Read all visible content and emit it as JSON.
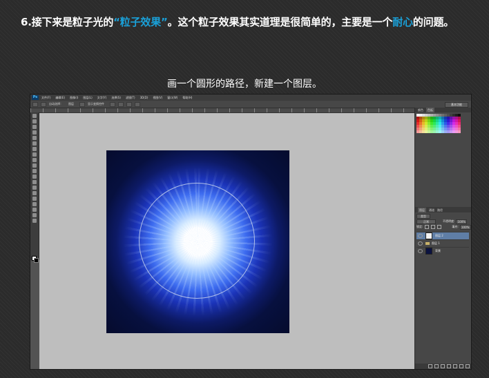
{
  "step_heading": {
    "prefix": "6.接下来是粒子光的",
    "highlight1": "“粒子效果”",
    "middle": "。这个粒子效果其实道理是很简单的，主要是一个",
    "highlight2": "耐心",
    "suffix": "的问题。"
  },
  "caption": "画一个圆形的路径，新建一个图层。",
  "colors": {
    "highlight": "#1aa0d8",
    "canvas_bg": "#050b2c",
    "glow_core": "#ffffff",
    "glow_mid": "#3d6cf0",
    "selected_layer": "#5f7ea6",
    "workspace_gray": "#bebebe"
  },
  "app": {
    "logo": "Ps",
    "menu": [
      "文件(F)",
      "编辑(E)",
      "图像(I)",
      "图层(L)",
      "文字(Y)",
      "选择(S)",
      "滤镜(T)",
      "3D(D)",
      "视图(V)",
      "窗口(W)",
      "帮助(H)"
    ],
    "options": {
      "auto_select": "自动选择：",
      "group": "图层",
      "show_transform": "显示变换控件"
    },
    "workspace": "基本功能"
  },
  "panels": {
    "tabs": [
      "颜色",
      "色板"
    ],
    "layers_tabs": [
      "图层",
      "通道",
      "路径"
    ],
    "blend_mode": "正常",
    "opacity_label": "不透明度:",
    "opacity": "100%",
    "lock_label": "锁定:",
    "fill_label": "填充:",
    "fill": "100%",
    "kind": "类型",
    "layers": [
      {
        "name": "图层 2",
        "selected": true
      },
      {
        "name": "图层 1",
        "selected": false
      },
      {
        "name": "背景",
        "selected": false
      }
    ]
  }
}
